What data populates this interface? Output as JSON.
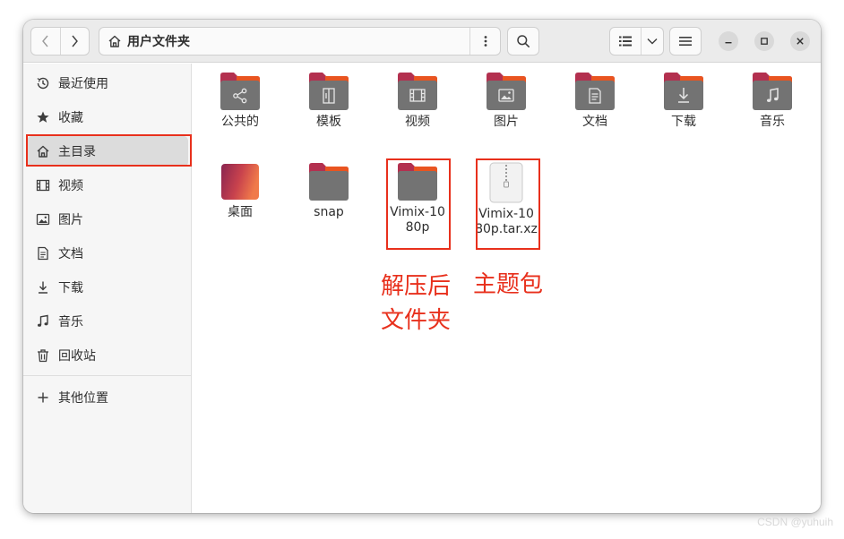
{
  "window": {
    "path_title": "用户文件夹"
  },
  "sidebar": {
    "items": [
      {
        "label": "最近使用",
        "icon": "clock-icon"
      },
      {
        "label": "收藏",
        "icon": "star-icon"
      },
      {
        "label": "主目录",
        "icon": "home-icon",
        "active": true
      },
      {
        "label": "视频",
        "icon": "film-icon"
      },
      {
        "label": "图片",
        "icon": "image-icon"
      },
      {
        "label": "文档",
        "icon": "document-icon"
      },
      {
        "label": "下载",
        "icon": "download-icon"
      },
      {
        "label": "音乐",
        "icon": "music-icon"
      },
      {
        "label": "回收站",
        "icon": "trash-icon"
      }
    ],
    "other": {
      "label": "其他位置",
      "icon": "plus-icon"
    }
  },
  "files": [
    {
      "label": "公共的",
      "icon": "share-icon",
      "kind": "folder"
    },
    {
      "label": "模板",
      "icon": "template-icon",
      "kind": "folder"
    },
    {
      "label": "视频",
      "icon": "film-icon",
      "kind": "folder"
    },
    {
      "label": "图片",
      "icon": "image-icon",
      "kind": "folder"
    },
    {
      "label": "文档",
      "icon": "document-icon",
      "kind": "folder"
    },
    {
      "label": "下载",
      "icon": "download-icon",
      "kind": "folder"
    },
    {
      "label": "音乐",
      "icon": "music-icon",
      "kind": "folder"
    },
    {
      "label": "桌面",
      "icon": "desktop-icon",
      "kind": "desktop"
    },
    {
      "label": "snap",
      "icon": "folder-icon",
      "kind": "folder"
    },
    {
      "label": "Vimix-1080p",
      "icon": "folder-icon",
      "kind": "folder"
    },
    {
      "label": "Vimix-1080p.tar.xz",
      "icon": "archive-icon",
      "kind": "archive"
    }
  ],
  "annotations": {
    "extracted_line1": "解压后",
    "extracted_line2": "文件夹",
    "theme_pack": "主题包"
  },
  "watermark": "CSDN @yuhuih",
  "colors": {
    "accent_orange": "#e95420",
    "folder_gray": "#737373",
    "annotation_red": "#e8301c"
  }
}
